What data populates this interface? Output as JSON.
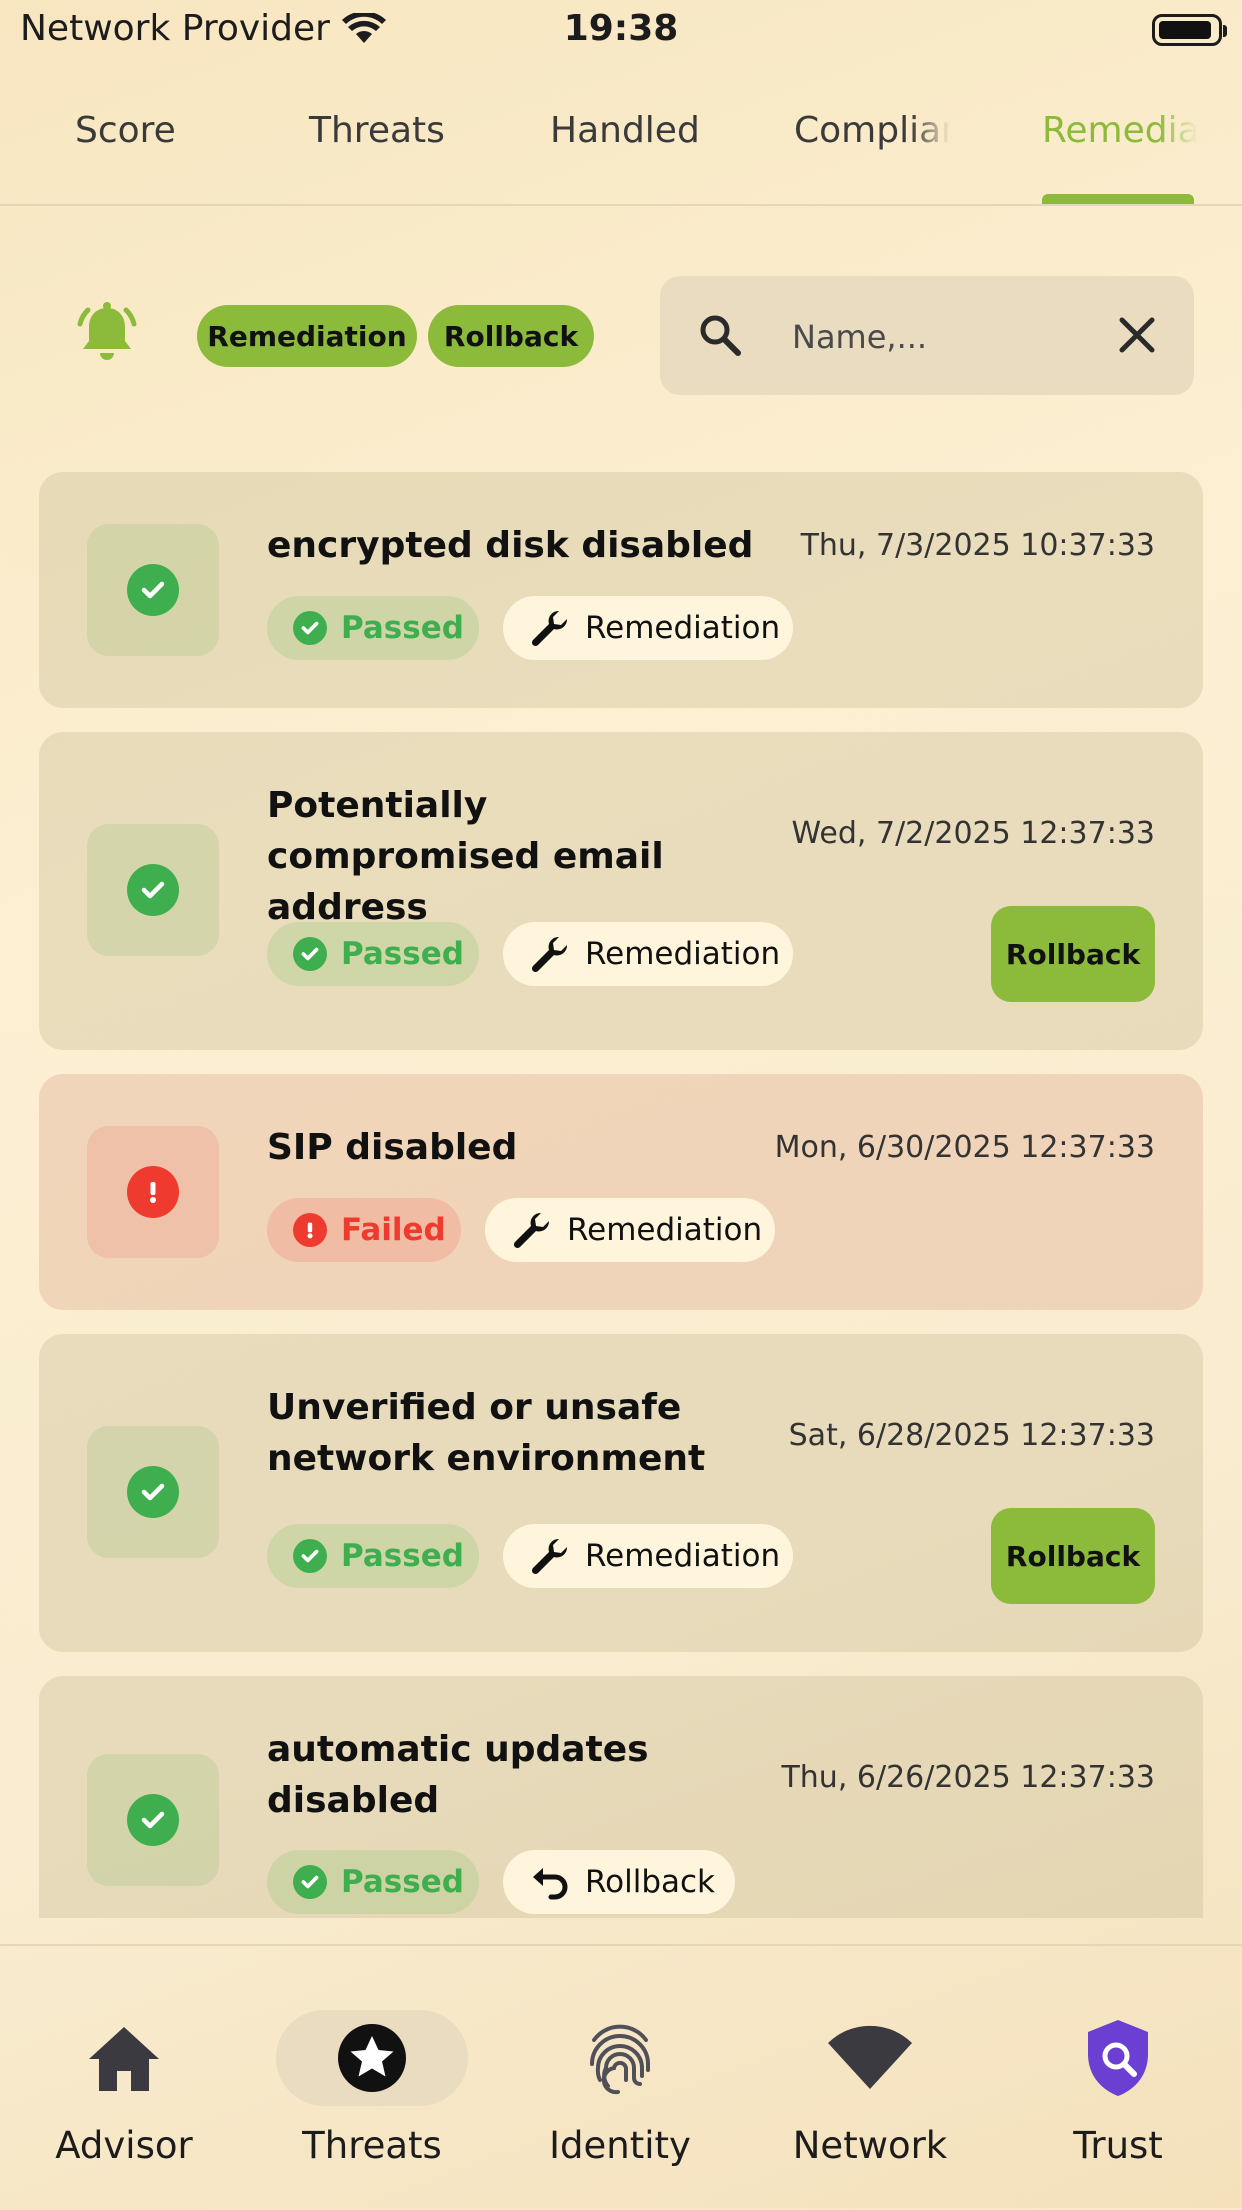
{
  "status_bar": {
    "carrier": "Network Provider",
    "time": "19:38"
  },
  "tabs": [
    {
      "label": "Score"
    },
    {
      "label": "Threats"
    },
    {
      "label": "Handled"
    },
    {
      "label": "Compliance"
    },
    {
      "label": "Remediation",
      "active": true
    }
  ],
  "filters": {
    "chips": [
      "Remediation",
      "Rollback"
    ],
    "search_placeholder": "Name,..."
  },
  "items": [
    {
      "title": "encrypted disk disabled",
      "date": "Thu, 7/3/2025 10:37:33",
      "status": "Passed",
      "action": "Remediation",
      "rollback_button": ""
    },
    {
      "title": "Potentially compromised email address",
      "date": "Wed, 7/2/2025 12:37:33",
      "status": "Passed",
      "action": "Remediation",
      "rollback_button": "Rollback"
    },
    {
      "title": "SIP disabled",
      "date": "Mon, 6/30/2025 12:37:33",
      "status": "Failed",
      "action": "Remediation",
      "rollback_button": ""
    },
    {
      "title": "Unverified or unsafe network environment",
      "date": "Sat, 6/28/2025 12:37:33",
      "status": "Passed",
      "action": "Remediation",
      "rollback_button": "Rollback"
    },
    {
      "title": "automatic updates disabled",
      "date": "Thu, 6/26/2025 12:37:33",
      "status": "Passed",
      "action": "Rollback",
      "rollback_button": ""
    }
  ],
  "bottom_nav": [
    {
      "label": "Advisor",
      "icon": "home-icon"
    },
    {
      "label": "Threats",
      "icon": "star-badge-icon",
      "active": true
    },
    {
      "label": "Identity",
      "icon": "fingerprint-icon"
    },
    {
      "label": "Network",
      "icon": "wifi-icon"
    },
    {
      "label": "Trust",
      "icon": "shield-search-icon"
    }
  ],
  "colors": {
    "accent": "#8cbb3b",
    "passed": "#3fae4e",
    "failed": "#ef3b2f",
    "trust": "#6a3fd1"
  }
}
